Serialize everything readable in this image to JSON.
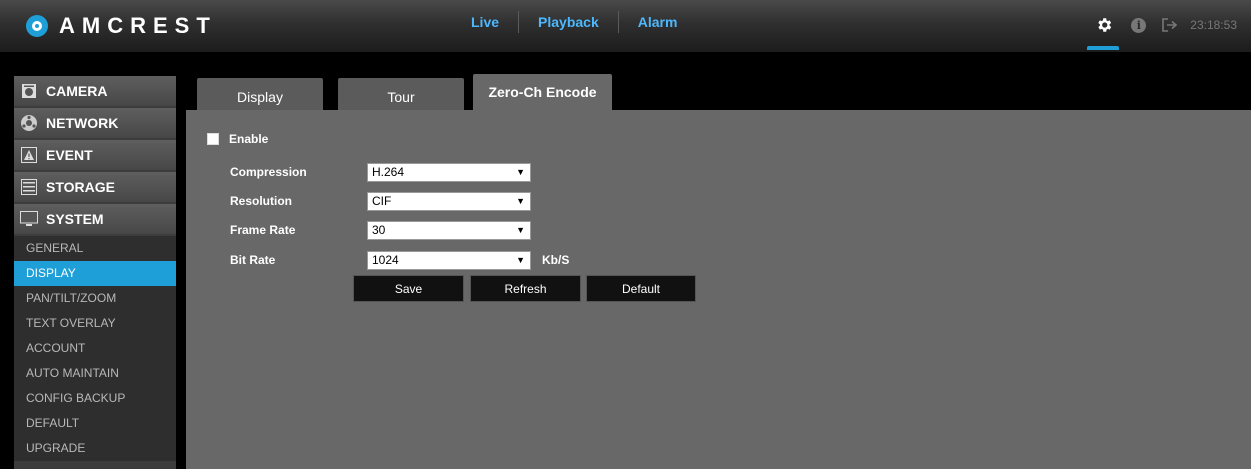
{
  "header": {
    "brand": "AMCREST",
    "nav": [
      {
        "label": "Live"
      },
      {
        "label": "Playback"
      },
      {
        "label": "Alarm"
      }
    ],
    "time": "23:18:53",
    "accent": "#1e9fd8"
  },
  "sidebar": {
    "sections": [
      {
        "label": "CAMERA",
        "icon": "camera-icon"
      },
      {
        "label": "NETWORK",
        "icon": "network-icon"
      },
      {
        "label": "EVENT",
        "icon": "event-icon"
      },
      {
        "label": "STORAGE",
        "icon": "storage-icon"
      },
      {
        "label": "SYSTEM",
        "icon": "monitor-icon"
      }
    ],
    "system_items": [
      {
        "label": "GENERAL"
      },
      {
        "label": "DISPLAY"
      },
      {
        "label": "PAN/TILT/ZOOM"
      },
      {
        "label": "TEXT OVERLAY"
      },
      {
        "label": "ACCOUNT"
      },
      {
        "label": "AUTO MAINTAIN"
      },
      {
        "label": "CONFIG BACKUP"
      },
      {
        "label": "DEFAULT"
      },
      {
        "label": "UPGRADE"
      }
    ],
    "active_item": "DISPLAY"
  },
  "tabs": [
    {
      "label": "Display"
    },
    {
      "label": "Tour"
    },
    {
      "label": "Zero-Ch Encode"
    }
  ],
  "active_tab": "Zero-Ch Encode",
  "form": {
    "enable_label": "Enable",
    "enable_checked": false,
    "compression": {
      "label": "Compression",
      "value": "H.264"
    },
    "resolution": {
      "label": "Resolution",
      "value": "CIF"
    },
    "frame_rate": {
      "label": "Frame Rate",
      "value": "30"
    },
    "bit_rate": {
      "label": "Bit Rate",
      "value": "1024",
      "unit": "Kb/S"
    }
  },
  "buttons": {
    "save": "Save",
    "refresh": "Refresh",
    "default": "Default"
  }
}
